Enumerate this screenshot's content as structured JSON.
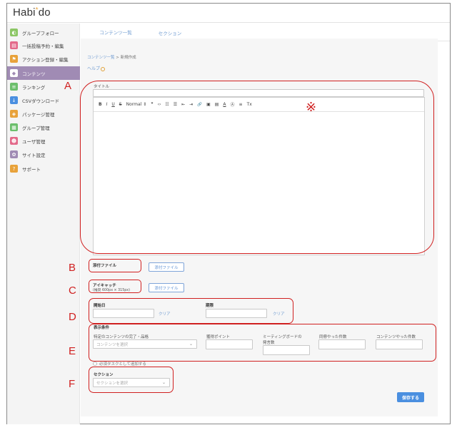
{
  "app": {
    "logo": "Habi",
    "logo_mark": "*",
    "logo_suffix": "do"
  },
  "sidebar": {
    "items": [
      {
        "label": "グループフォロー",
        "icon": "group-follow-icon",
        "color": "#8cc665"
      },
      {
        "label": "一括投稿予約・編集",
        "icon": "schedule-icon",
        "color": "#e36a8a"
      },
      {
        "label": "アクション登録・編集",
        "icon": "flag-icon",
        "color": "#e8a23a"
      },
      {
        "label": "コンテンツ",
        "icon": "content-icon",
        "color": "#a08bb4",
        "active": true
      },
      {
        "label": "ランキング",
        "icon": "ranking-icon",
        "color": "#6cbf6c"
      },
      {
        "label": "CSVダウンロード",
        "icon": "download-icon",
        "color": "#4a8fe0"
      },
      {
        "label": "パッケージ管理",
        "icon": "package-icon",
        "color": "#e8a23a"
      },
      {
        "label": "グループ管理",
        "icon": "group-manage-icon",
        "color": "#6cbf6c"
      },
      {
        "label": "ユーザ管理",
        "icon": "user-manage-icon",
        "color": "#e36a8a"
      },
      {
        "label": "サイト設定",
        "icon": "gear-icon",
        "color": "#a08bb4"
      },
      {
        "label": "サポート",
        "icon": "support-icon",
        "color": "#e8a23a"
      }
    ]
  },
  "tabs": {
    "list": "コンテンツ一覧",
    "section": "セクション"
  },
  "breadcrumb": {
    "parent": "コンテンツ一覧",
    "sep": " > ",
    "current": "新規作成"
  },
  "help": "ヘルプ",
  "form": {
    "title_label": "タイトル",
    "toolbar": {
      "bold": "B",
      "italic": "I",
      "underline": "U",
      "strike": "S",
      "font_size": "Normal",
      "font_size_arrow": "⇕",
      "quote": "❞",
      "code": "‹›",
      "ol": "☷",
      "ul": "☰",
      "indent_out": "⇤",
      "indent_in": "⇥",
      "link": "🔗",
      "image": "▣",
      "video": "▤",
      "font_color": "A",
      "background": "Ⓐ",
      "align": "≡",
      "clear": "Tx"
    },
    "attach_label": "添付ファイル",
    "attach_button": "添付ファイル",
    "eyecatch_label": "アイキャッチ",
    "eyecatch_note": "(推奨 600px × 315px)",
    "eyecatch_button": "添付ファイル",
    "start_label": "開始日",
    "end_label": "期限",
    "clear": "クリア",
    "display_label": "表示条件",
    "cond_content_label": "特定のコンテンツの完了・品格",
    "cond_content_placeholder": "コンテンツを選択",
    "cond_points_label": "獲得ポイント",
    "cond_meeting_label": "ミーティングボードの",
    "cond_meeting_label2": "発言数",
    "cond_same_label": "同僚やった件数",
    "cond_content_count_label": "コンテンツやった件数",
    "required_task": "必須タスクとして追加する",
    "section_label": "セクション",
    "section_placeholder": "セクションを選択",
    "save": "保存する"
  },
  "annotations": {
    "A": "A",
    "B": "B",
    "C": "C",
    "D": "D",
    "E": "E",
    "F": "F",
    "asterisk": "※",
    "color": "#d02020"
  }
}
